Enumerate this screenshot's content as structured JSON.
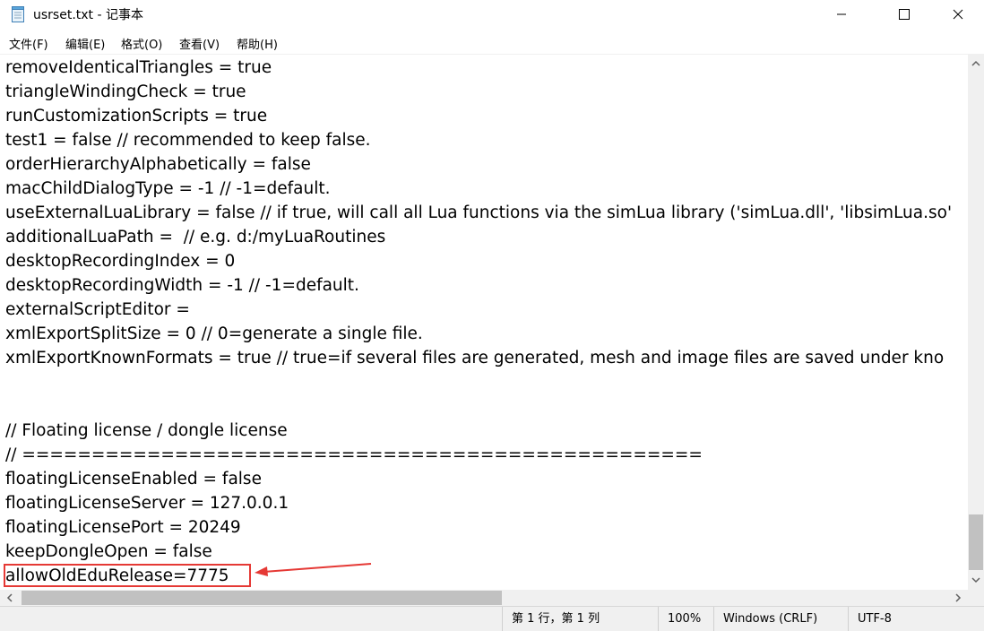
{
  "window": {
    "title": "usrset.txt - 记事本",
    "icon": "notepad-icon",
    "controls": [
      "minimize-icon",
      "maximize-icon",
      "close-icon"
    ]
  },
  "menu": {
    "items": [
      "文件(F)",
      "编辑(E)",
      "格式(O)",
      "查看(V)",
      "帮助(H)"
    ]
  },
  "editor": {
    "lines": [
      "removeIdenticalTriangles = true",
      "triangleWindingCheck = true",
      "runCustomizationScripts = true",
      "test1 = false // recommended to keep false.",
      "orderHierarchyAlphabetically = false",
      "macChildDialogType = -1 // -1=default.",
      "useExternalLuaLibrary = false // if true, will call all Lua functions via the simLua library ('simLua.dll', 'libsimLua.so'",
      "additionalLuaPath =  // e.g. d:/myLuaRoutines",
      "desktopRecordingIndex = 0",
      "desktopRecordingWidth = -1 // -1=default.",
      "externalScriptEditor = ",
      "xmlExportSplitSize = 0 // 0=generate a single file.",
      "xmlExportKnownFormats = true // true=if several files are generated, mesh and image files are saved under kno",
      "",
      "",
      "// Floating license / dongle license",
      "// =================================================",
      "floatingLicenseEnabled = false",
      "floatingLicenseServer = 127.0.0.1",
      "floatingLicensePort = 20249",
      "keepDongleOpen = false",
      "allowOldEduRelease=7775"
    ],
    "highlighted_line": "allowOldEduRelease=7775",
    "annotation_color": "#e53935"
  },
  "status": {
    "position": "第 1 行，第 1 列",
    "zoom": "100%",
    "line_ending": "Windows (CRLF)",
    "encoding": "UTF-8"
  },
  "colors": {
    "background": "#ffffff",
    "chrome": "#f0f0f0",
    "scroll_thumb": "#c1c1c1"
  }
}
